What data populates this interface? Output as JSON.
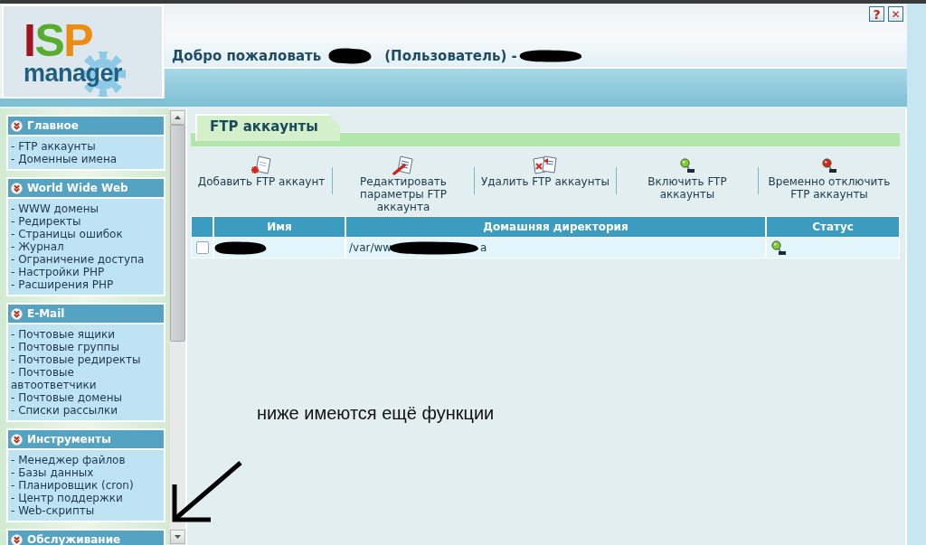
{
  "header": {
    "logo": {
      "letters": [
        {
          "text": "I",
          "color": "#a3121f"
        },
        {
          "text": "S",
          "color": "#5aac2c"
        },
        {
          "text": "P",
          "color": "#ec8c10"
        }
      ],
      "word": "manager"
    },
    "buttons": [
      {
        "kind": "help",
        "label": "?"
      },
      {
        "kind": "close",
        "label": "✕"
      }
    ],
    "welcome": {
      "greeting": "Добро пожаловать",
      "role": "(Пользователь) -"
    }
  },
  "sidebar": {
    "sections": [
      {
        "title": "Главное",
        "items": [
          "- FTP аккаунты",
          "- Доменные имена"
        ]
      },
      {
        "title": "World Wide Web",
        "items": [
          "- WWW домены",
          "- Редиректы",
          "- Страницы ошибок",
          "- Журнал",
          "- Ограничение доступа",
          "- Настройки PHP",
          "- Расширения PHP"
        ]
      },
      {
        "title": "E-Mail",
        "items": [
          "- Почтовые ящики",
          "- Почтовые группы",
          "- Почтовые редиректы",
          "- Почтовые автоответчики",
          "- Почтовые домены",
          "- Списки рассылки"
        ]
      },
      {
        "title": "Инструменты",
        "items": [
          "- Менеджер файлов",
          "- Базы данных",
          "- Планировщик (cron)",
          "- Центр поддержки",
          "- Web-скрипты"
        ]
      },
      {
        "title": "Обслуживание"
      }
    ]
  },
  "main": {
    "tabs": [
      {
        "label": "FTP аккаунты",
        "selected": true
      }
    ],
    "toolbar": [
      {
        "kind": "add",
        "label": "Добавить FTP аккаунт"
      },
      {
        "kind": "edit",
        "label": "Редактировать параметры FTP аккаунта"
      },
      {
        "kind": "delete",
        "label": "Удалить FTP аккаунты"
      },
      {
        "kind": "enable",
        "label": "Включить FTP аккаунты"
      },
      {
        "kind": "disable",
        "label": "Временно отключить FTP аккаунты"
      }
    ],
    "table": {
      "columns": [
        "Имя",
        "Домашняя директория",
        "Статус"
      ],
      "rows": [
        {
          "checked": false,
          "home_dir_start": "/var/ww",
          "home_dir_end": "a",
          "enabled": true
        }
      ]
    }
  },
  "annotation": {
    "text": "ниже имеются ещё функции"
  }
}
